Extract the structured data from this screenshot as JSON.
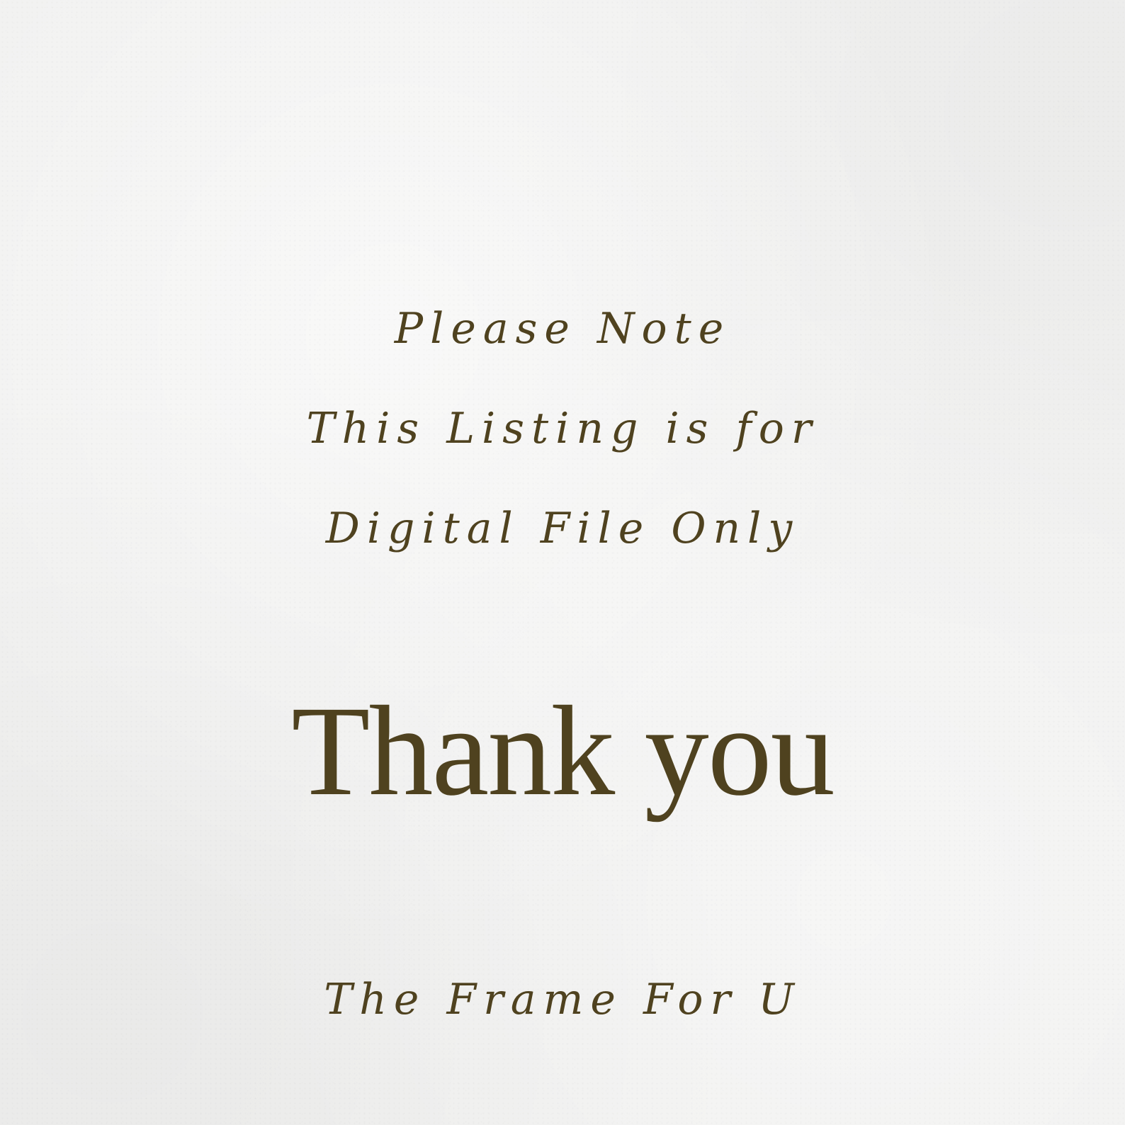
{
  "note": {
    "heading": "Please Note",
    "line_1": "This Listing is for",
    "line_2": "Digital File Only"
  },
  "message": {
    "thank_you": "Thank you"
  },
  "footer": {
    "shop_name": "The Frame For U"
  },
  "colors": {
    "text": "#4f421f",
    "paper": "#f1f1f0"
  }
}
